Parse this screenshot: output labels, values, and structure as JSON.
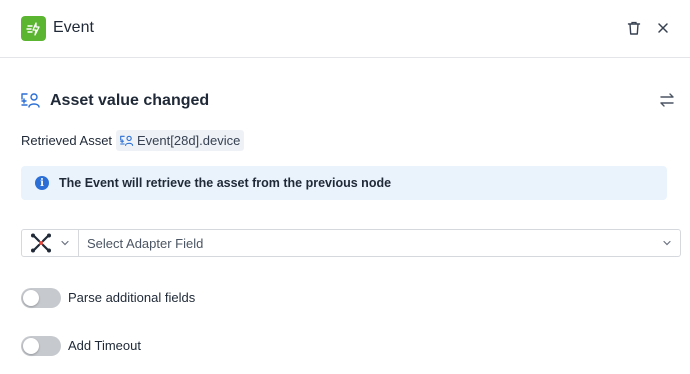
{
  "header": {
    "title": "Event",
    "icon": "event-bolt-icon",
    "icon_bg": "#5bb531",
    "actions": [
      "trash-icon",
      "close-icon"
    ]
  },
  "section": {
    "title": "Asset value changed",
    "icon": "asset-person-icon",
    "action_icon": "swap-arrows-icon"
  },
  "retrieved_asset": {
    "label": "Retrieved Asset",
    "chip_icon": "asset-person-icon",
    "chip_text": "Event[28d].device"
  },
  "info_banner": {
    "icon": "info-icon",
    "text": "The Event will retrieve the asset from the previous node",
    "bg": "#eaf3fc"
  },
  "adapter_select": {
    "adapter_icon": "adapter-logo-icon",
    "field_placeholder": "Select Adapter Field"
  },
  "toggles": [
    {
      "label": "Parse additional fields",
      "checked": false
    },
    {
      "label": "Add Timeout",
      "checked": false
    }
  ],
  "colors": {
    "accent_blue": "#2b6fd6",
    "toggle_off": "#c6c9ce"
  }
}
